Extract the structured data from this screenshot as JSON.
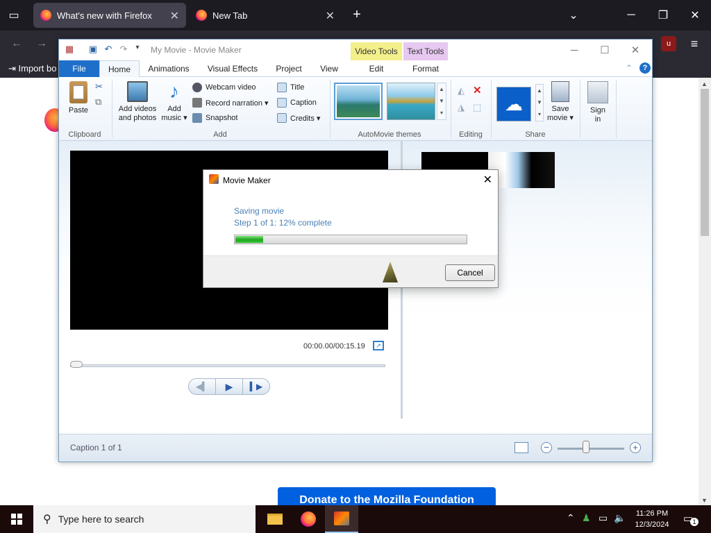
{
  "browser": {
    "tabs": [
      {
        "label": "What's new with Firefox"
      },
      {
        "label": "New Tab"
      }
    ],
    "bookmarks": {
      "import_label": "Import bo"
    },
    "page": {
      "donate_label": "Donate to the Mozilla Foundation"
    }
  },
  "moviemaker": {
    "title": "My Movie - Movie Maker",
    "context_tabs": {
      "video_tools": "Video Tools",
      "text_tools": "Text Tools"
    },
    "tabs": [
      "File",
      "Home",
      "Animations",
      "Visual Effects",
      "Project",
      "View",
      "Edit",
      "Format"
    ],
    "ribbon": {
      "clipboard": {
        "paste": "Paste",
        "group": "Clipboard"
      },
      "add": {
        "add_videos_line1": "Add videos",
        "add_videos_line2": "and photos",
        "add_music_line1": "Add",
        "add_music_line2": "music ▾",
        "webcam": "Webcam video",
        "record": "Record narration ▾",
        "snapshot": "Snapshot",
        "title": "Title",
        "caption": "Caption",
        "credits": "Credits ▾",
        "group": "Add"
      },
      "themes": {
        "group": "AutoMovie themes"
      },
      "editing": {
        "group": "Editing"
      },
      "share": {
        "save_line1": "Save",
        "save_line2": "movie ▾",
        "sign_line1": "Sign",
        "sign_line2": "in",
        "group": "Share"
      }
    },
    "preview": {
      "timecode": "00:00.00/00:15.19"
    },
    "status": {
      "caption": "Caption 1 of 1"
    }
  },
  "dialog": {
    "title": "Movie Maker",
    "line1": "Saving movie",
    "line2": "Step 1 of 1: 12% complete",
    "progress": 0.12,
    "cancel": "Cancel"
  },
  "taskbar": {
    "search_placeholder": "Type here to search",
    "time": "11:26 PM",
    "date": "12/3/2024",
    "notification_count": "1"
  },
  "colors": {
    "accent": "#1e6fc9",
    "progress": "#1fa51f",
    "taskbar": "#1a0a0a"
  }
}
